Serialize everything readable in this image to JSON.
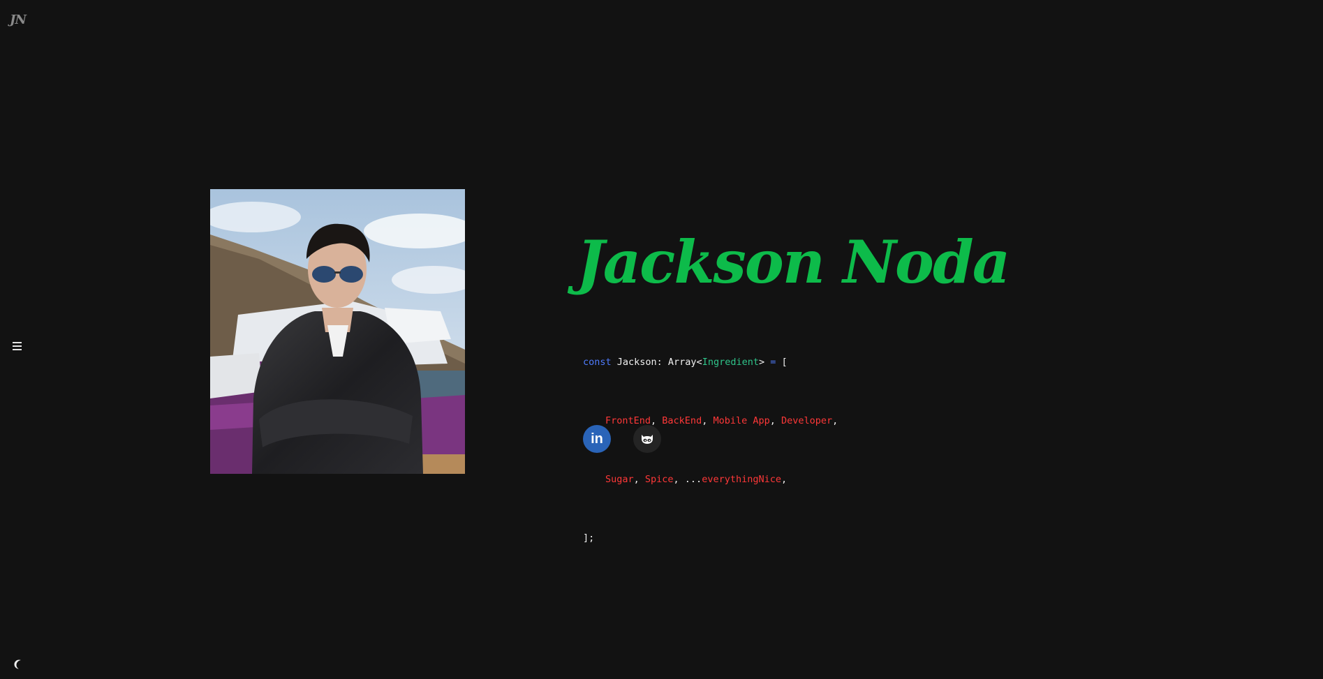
{
  "logo": {
    "text": "JN"
  },
  "icons": {
    "menu": "menu-icon",
    "theme": "moon-icon",
    "linkedin": "linkedin-icon",
    "github": "github-icon"
  },
  "profile": {
    "name": "Jackson Noda",
    "name_color": "#0dbb4a"
  },
  "code": {
    "line1": {
      "keyword": "const",
      "variable": " Jackson: Array<",
      "type": "Ingredient",
      "close": ">",
      "equals": " = ",
      "bracket": "["
    },
    "line2": [
      {
        "value": "FrontEnd",
        "sep": ", "
      },
      {
        "value": "BackEnd",
        "sep": ", "
      },
      {
        "value": "Mobile App",
        "sep": ", "
      },
      {
        "value": "Developer",
        "sep": ","
      }
    ],
    "line3": [
      {
        "value": "Sugar",
        "sep": ", "
      },
      {
        "value": "Spice",
        "sep": ", ..."
      },
      {
        "value": "everythingNice",
        "sep": ","
      }
    ],
    "line4": "];"
  },
  "social": {
    "linkedin_label": "in",
    "linkedin_color": "#2a64b8",
    "github_color": "#242424"
  },
  "theme": {
    "background": "#121212",
    "keyword_color": "#4f7cff",
    "type_color": "#2fc48a",
    "string_color": "#ff3838"
  }
}
